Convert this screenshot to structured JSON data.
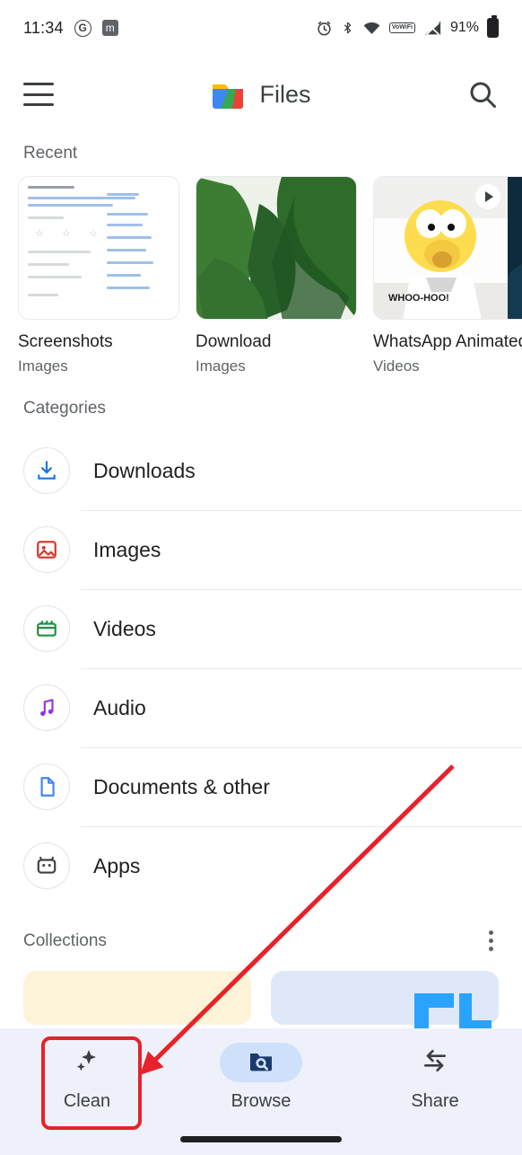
{
  "status_bar": {
    "time": "11:34",
    "icons_left": [
      "google-icon",
      "m-icon"
    ],
    "icons_right": [
      "alarm-icon",
      "bluetooth-icon",
      "wifi-icon",
      "volte-icon",
      "signal-icon"
    ],
    "volte_label_top": "Vo",
    "volte_label_bottom": "WiFi",
    "battery_percent": "91%"
  },
  "app_bar": {
    "menu_icon": "hamburger-menu-icon",
    "title": "Files",
    "search_icon": "search-icon"
  },
  "recent": {
    "section_label": "Recent",
    "items": [
      {
        "title": "Screenshots",
        "subtitle": "Images",
        "kind": "document-thumbnail"
      },
      {
        "title": "Download",
        "subtitle": "Images",
        "kind": "photo-thumbnail"
      },
      {
        "title": "WhatsApp Animated...",
        "subtitle": "Videos",
        "kind": "video-thumbnail"
      }
    ]
  },
  "categories": {
    "section_label": "Categories",
    "items": [
      {
        "label": "Downloads",
        "icon": "download-icon",
        "color": "#1a73e8"
      },
      {
        "label": "Images",
        "icon": "image-icon",
        "color": "#d93025"
      },
      {
        "label": "Videos",
        "icon": "video-icon",
        "color": "#1e8e3e"
      },
      {
        "label": "Audio",
        "icon": "music-note-icon",
        "color": "#9334e6"
      },
      {
        "label": "Documents & other",
        "icon": "document-icon",
        "color": "#4285f4"
      },
      {
        "label": "Apps",
        "icon": "apps-icon",
        "color": "#3c4043"
      }
    ]
  },
  "collections": {
    "section_label": "Collections",
    "more_icon": "overflow-menu-icon"
  },
  "bottom_nav": {
    "items": [
      {
        "label": "Clean",
        "icon": "sparkle-icon",
        "active": false
      },
      {
        "label": "Browse",
        "icon": "folder-search-icon",
        "active": true
      },
      {
        "label": "Share",
        "icon": "share-arrows-icon",
        "active": false
      }
    ]
  },
  "annotations": {
    "highlight_target": "Clean",
    "accent_color": "#e8212a"
  }
}
